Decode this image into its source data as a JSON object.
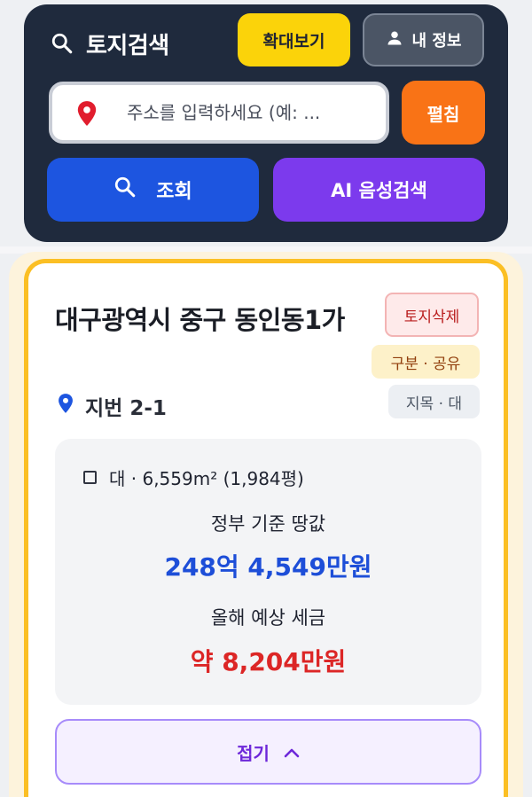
{
  "header": {
    "title": "토지검색",
    "expand_label": "확대보기",
    "profile_label": "내 정보",
    "search_placeholder": "주소를 입력하세요 (예: ...",
    "unfold_label": "펼침",
    "query_label": "조회",
    "ai_label": "AI 음성검색"
  },
  "result": {
    "address": "대구광역시 중구 동인동1가",
    "badges": {
      "delete": "토지삭제",
      "share": "구분 · 공유",
      "jimok": "지목 · 대"
    },
    "jibeon": "지번 2-1",
    "area": "대 · 6,559m² (1,984평)",
    "gov_price_label": "정부 기준 땅값",
    "gov_price_value": "248억 4,549만원",
    "tax_label": "올해 예상 세금",
    "tax_value": "약 8,204만원",
    "fold_label": "접기"
  },
  "colors": {
    "header_bg": "#1f2a3d",
    "expand_btn": "#fbd30a",
    "unfold_btn": "#f97316",
    "query_btn": "#1d55e0",
    "ai_btn": "#7c3aed",
    "card_border": "#fbbf24",
    "price_blue": "#1d4ed8",
    "tax_red": "#dc2626"
  },
  "icons": {
    "title": "search-icon",
    "profile": "user-icon",
    "search_field": "map-pin-icon",
    "query": "search-icon",
    "jibeon": "map-pin-icon",
    "area": "square-icon",
    "fold": "chevron-up-icon"
  }
}
